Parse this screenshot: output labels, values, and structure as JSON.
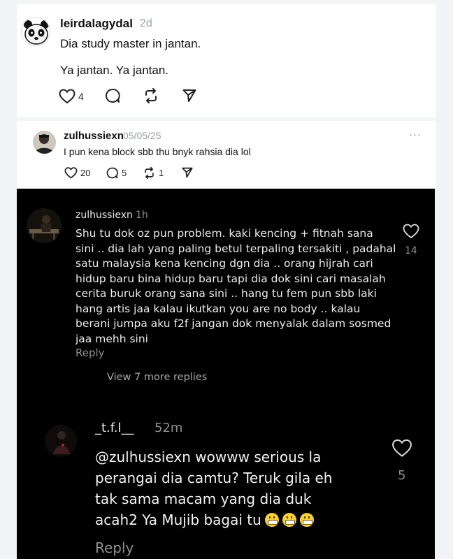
{
  "post1": {
    "username": "leirdalagydal",
    "time": "2d",
    "line1": "Dia study master in jantan.",
    "line2": "Ya jantan. Ya jantan.",
    "likes": "4"
  },
  "post2": {
    "username": "zulhussiexn",
    "date": "05/05/25",
    "text": "I pun kena block sbb thu bnyk rahsia dia lol",
    "likes": "20",
    "replies": "5",
    "reposts": "1",
    "more": "···"
  },
  "screenshot": {
    "comment1": {
      "username": "zulhussiexn",
      "time": "1h",
      "text": "Shu tu dok oz pun problem. kaki kencing + fitnah sana\nsini .. dia lah yang paling betul terpaling tersakiti , padahal\nsatu malaysia kena kencing dgn dia .. orang hijrah cari\nhidup baru bina hidup baru tapi dia dok sini cari masalah\ncerita buruk orang sana sini .. hang tu fem pun sbb laki\nhang artis jaa kalau ikutkan you are no body .. kalau\nberani jumpa aku f2f jangan dok menyalak dalam sosmed\njaa mehh sini",
      "likes": "14",
      "reply_label": "Reply",
      "view_more": "View 7 more replies"
    },
    "comment2": {
      "username": "_t.f.l__",
      "time": "52m",
      "text": "@zulhussiexn wowww serious la\nperangai dia camtu? Teruk gila eh\ntak sama macam yang dia duk\nacah2 Ya Mujib bagai tu",
      "likes": "5",
      "reply_label": "Reply"
    }
  },
  "colors": {
    "dark_bg": "#000000",
    "panel_bg": "#ffffff",
    "page_bg": "#f3f4f6"
  }
}
